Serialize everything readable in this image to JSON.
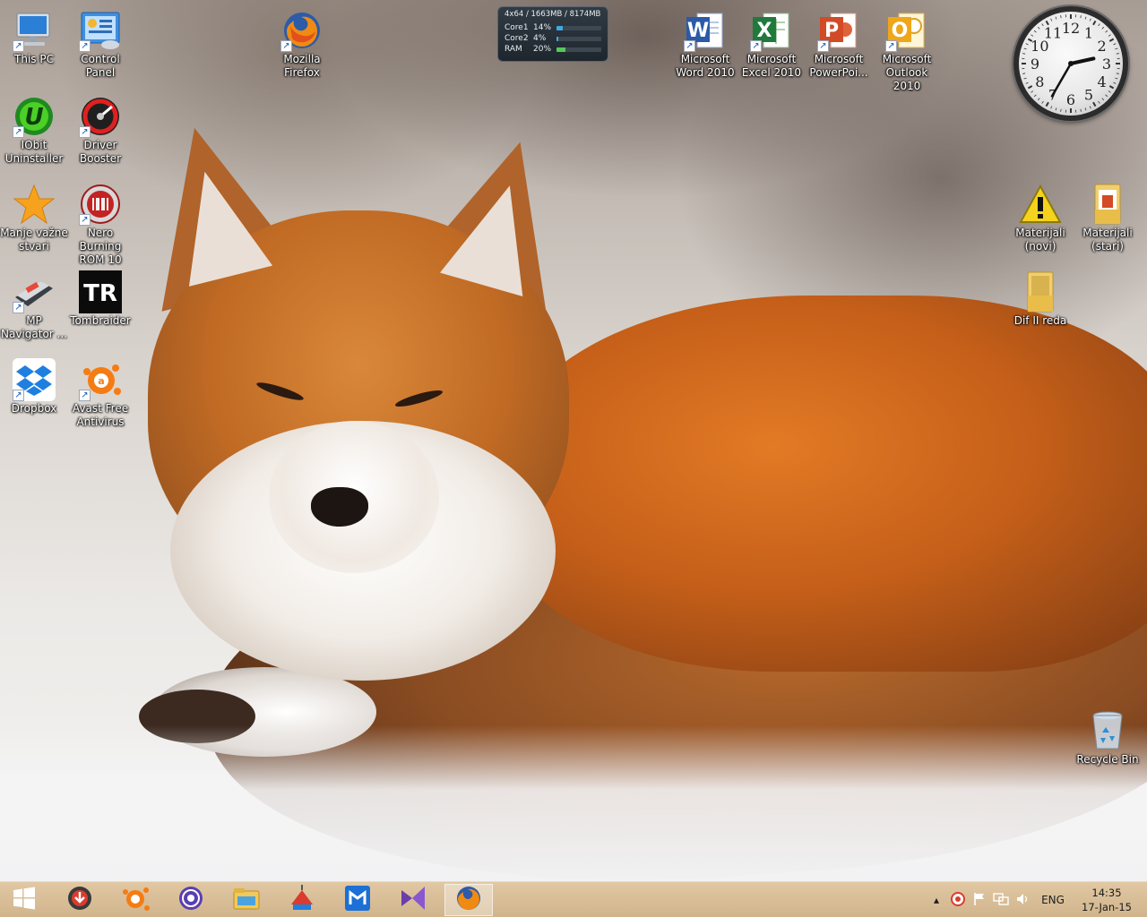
{
  "desktop": {
    "icons": [
      {
        "id": "this-pc",
        "label": "This PC",
        "icon": "computer-icon"
      },
      {
        "id": "control-panel",
        "label": "Control\nPanel",
        "icon": "control-panel-icon"
      },
      {
        "id": "mozilla-firefox",
        "label": "Mozilla\nFirefox",
        "icon": "firefox-icon"
      },
      {
        "id": "iobit-uninstaller",
        "label": "IObit\nUninstaller",
        "icon": "iobit-uninstaller-icon"
      },
      {
        "id": "driver-booster",
        "label": "Driver\nBooster",
        "icon": "driver-booster-icon"
      },
      {
        "id": "manje-vazne-stvari",
        "label": "Manje važne\nstvari",
        "icon": "star-icon"
      },
      {
        "id": "nero-burning-rom",
        "label": "Nero Burning\nROM 10",
        "icon": "nero-icon"
      },
      {
        "id": "mp-navigator",
        "label": "MP\nNavigator ...",
        "icon": "scanner-icon"
      },
      {
        "id": "tombraider",
        "label": "Tombraider",
        "icon": "tombraider-icon"
      },
      {
        "id": "dropbox",
        "label": "Dropbox",
        "icon": "dropbox-icon"
      },
      {
        "id": "avast",
        "label": "Avast Free\nAntivirus",
        "icon": "avast-icon"
      },
      {
        "id": "ms-word",
        "label": "Microsoft\nWord 2010",
        "icon": "word-icon"
      },
      {
        "id": "ms-excel",
        "label": "Microsoft\nExcel 2010",
        "icon": "excel-icon"
      },
      {
        "id": "ms-powerpoint",
        "label": "Microsoft\nPowerPoi...",
        "icon": "powerpoint-icon"
      },
      {
        "id": "ms-outlook",
        "label": "Microsoft\nOutlook 2010",
        "icon": "outlook-icon"
      },
      {
        "id": "materijali-novi",
        "label": "Materijali\n(novi)",
        "icon": "warning-icon"
      },
      {
        "id": "materijali-stari",
        "label": "Materijali\n(stari)",
        "icon": "folder-icon"
      },
      {
        "id": "dif-ii-reda",
        "label": "Dif II reda",
        "icon": "folder-icon"
      },
      {
        "id": "recycle-bin",
        "label": "Recycle Bin",
        "icon": "recycle-bin-icon"
      }
    ]
  },
  "cpu_gadget": {
    "header": "4x64 / 1663MB / 8174MB",
    "rows": [
      {
        "name": "Core1",
        "value": "14%",
        "fraction": 0.14,
        "color": "#3fa9e0"
      },
      {
        "name": "Core2",
        "value": "4%",
        "fraction": 0.04,
        "color": "#3fa9e0"
      },
      {
        "name": "RAM",
        "value": "20%",
        "fraction": 0.2,
        "color": "#57c75a"
      }
    ]
  },
  "clock_gadget": {
    "numbers": [
      "12",
      "1",
      "2",
      "3",
      "4",
      "5",
      "6",
      "7",
      "8",
      "9",
      "10",
      "11"
    ],
    "time": {
      "hours": 14,
      "minutes": 35
    }
  },
  "taskbar": {
    "start_icon": "windows-start-icon",
    "pinned": [
      {
        "id": "downloader",
        "icon": "download-manager-icon"
      },
      {
        "id": "avast",
        "icon": "avast-icon"
      },
      {
        "id": "bittorrent",
        "icon": "bittorrent-icon"
      },
      {
        "id": "file-explorer",
        "icon": "file-explorer-icon"
      },
      {
        "id": "ccleaner",
        "icon": "ccleaner-icon"
      },
      {
        "id": "maxthon",
        "icon": "maxthon-icon"
      },
      {
        "id": "visual-studio",
        "icon": "visual-studio-icon"
      },
      {
        "id": "firefox",
        "icon": "firefox-icon",
        "active": true
      }
    ],
    "tray": {
      "icons": [
        "chevron-up-icon",
        "avast-tray-icon",
        "flag-icon",
        "network-icon",
        "volume-icon"
      ],
      "language": "ENG",
      "time": "14:35",
      "date": "17-Jan-15"
    }
  }
}
